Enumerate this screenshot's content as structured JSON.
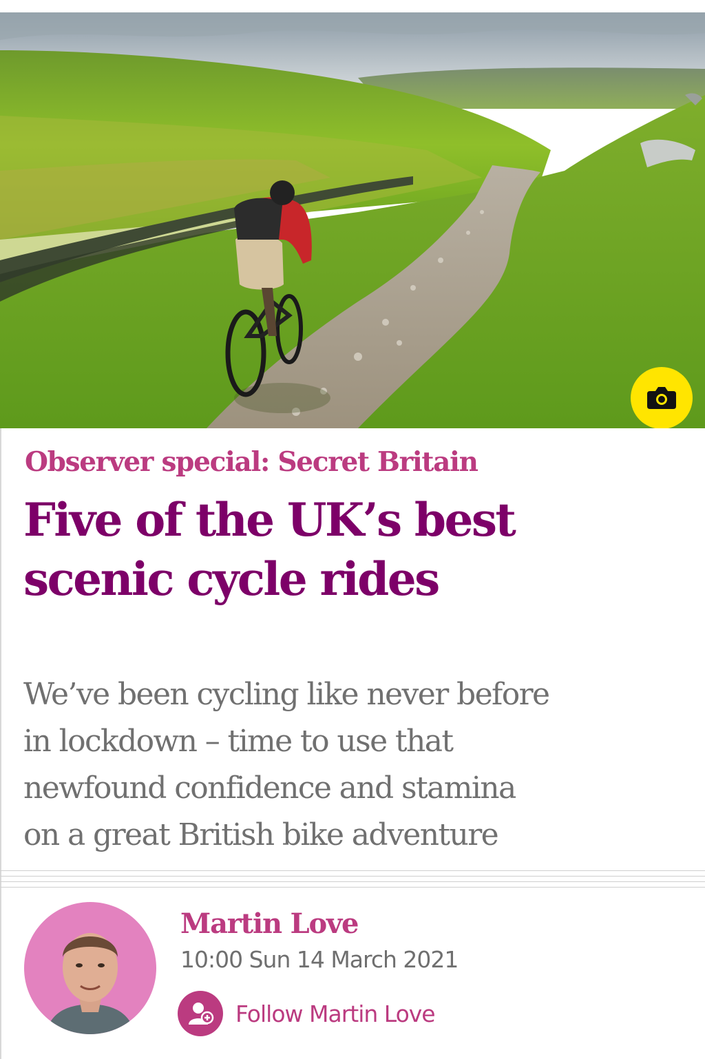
{
  "article": {
    "kicker": "Observer special: Secret Britain",
    "headline_line1": "Five of the UK’s best",
    "headline_line2": "scenic cycle rides",
    "standfirst_lines": [
      "We’ve been cycling like never before",
      "in lockdown – time to use that",
      "newfound confidence and stamina",
      "on a great British bike adventure"
    ]
  },
  "hero": {
    "camera_icon": "camera-icon",
    "camera_button_color": "#ffe500"
  },
  "byline": {
    "name": "Martin Love",
    "date": "10:00 Sun 14 March 2021",
    "follow_label": "Follow Martin Love",
    "follow_icon": "add-user-icon"
  },
  "colors": {
    "kicker": "#bb3b80",
    "headline": "#7d0068",
    "standfirst": "#707070",
    "avatar_bg": "#e382bf"
  }
}
